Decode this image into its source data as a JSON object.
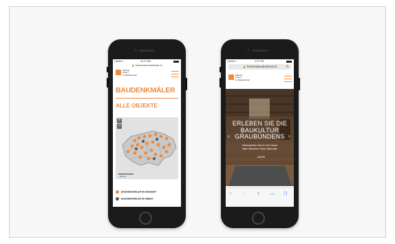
{
  "colors": {
    "accent": "#f08a3c",
    "ios_blue": "#2f7be0"
  },
  "left_phone": {
    "status": {
      "carrier": "Carrier ≈",
      "time": "11:17 AM"
    },
    "url": "🔒 ferienimbaudenkmal.ch",
    "logo": {
      "text": "Stiftung\nFerien\nim Baudenkmal"
    },
    "menu_icon": "hamburger-icon",
    "heading": "BAUDENKMÄLER",
    "subheading": "ALLE OBJEKTE",
    "map": {
      "zoom_in": "+",
      "zoom_out": "–",
      "scale": "100 km"
    },
    "legend": [
      {
        "label": "BAUDENKMÄLER IM ANGEBOT",
        "color": "#f08a3c"
      },
      {
        "label": "BAUDENKMÄLER IN ARBEIT",
        "color": "#555555"
      }
    ]
  },
  "right_phone": {
    "status": {
      "carrier": "Carrier ≈",
      "time": "2:37 PM"
    },
    "address": "🔒 ferienimbaudenkmal.ch",
    "reload_icon": "reload-icon",
    "logo": {
      "text": "Stiftung\nFerien\nim Baudenkmal"
    },
    "menu_icon": "hamburger-icon",
    "hero": {
      "title": "ERLEBEN SIE DIE\nBAUKULTUR\nGRAUBÜNDENS",
      "subtitle": "Übernachten Sie im 400 Jahre\nalten Bündner Haus Valendas",
      "more": "→ MEHR",
      "prev": "‹",
      "next": "›"
    },
    "toolbar": [
      "‹",
      "›",
      "⇪",
      "▭",
      "❐"
    ]
  }
}
